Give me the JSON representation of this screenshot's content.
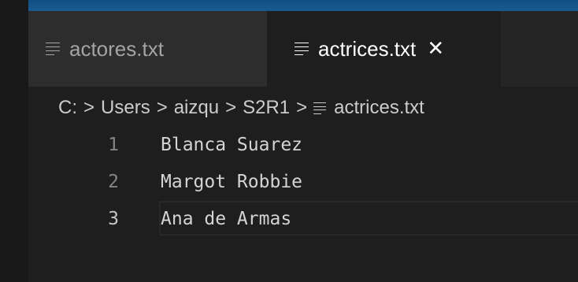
{
  "tabs": [
    {
      "label": "actores.txt",
      "icon": "file-text-icon",
      "active": false
    },
    {
      "label": "actrices.txt",
      "icon": "file-text-icon",
      "active": true
    }
  ],
  "breadcrumb": {
    "items": [
      "C:",
      "Users",
      "aizqu",
      "S2R1",
      "actrices.txt"
    ],
    "separator": ">"
  },
  "editor": {
    "lines": [
      {
        "number": "1",
        "text": "Blanca Suarez"
      },
      {
        "number": "2",
        "text": "Margot Robbie"
      },
      {
        "number": "3",
        "text": "Ana de Armas"
      }
    ],
    "current_line": "3"
  },
  "colors": {
    "background": "#1e1e1e",
    "tab_inactive": "#2d2d2d",
    "tab_active": "#1e1e1e",
    "accent_top": "#1a5b8f",
    "line_number": "#858585",
    "text": "#d4d4d4"
  }
}
